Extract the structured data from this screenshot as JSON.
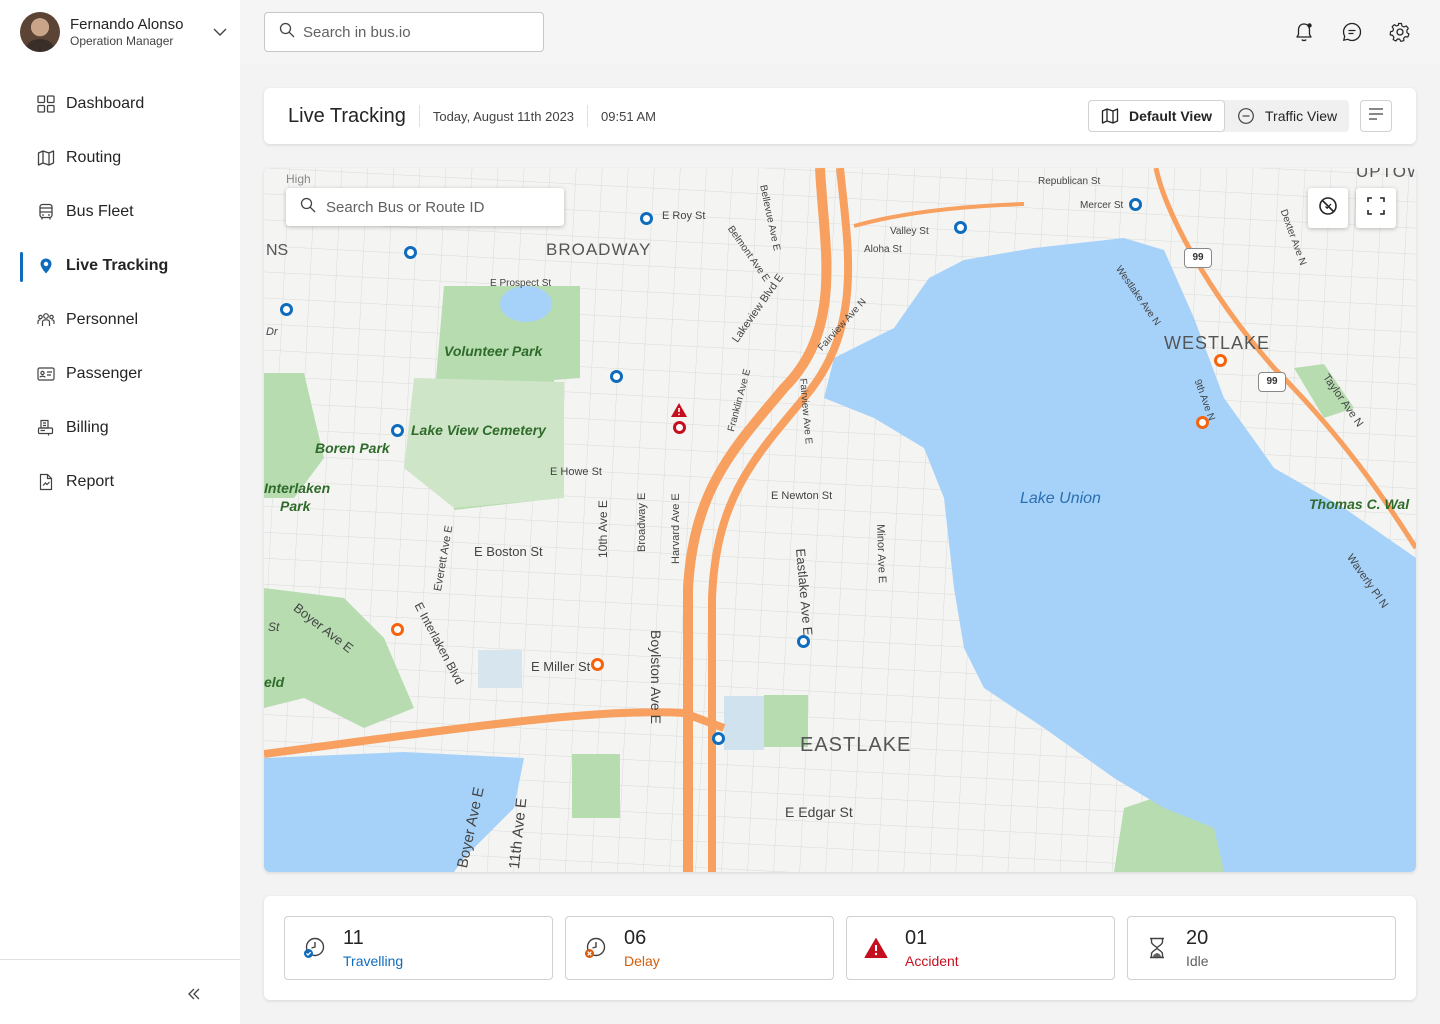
{
  "user": {
    "name": "Fernando Alonso",
    "role": "Operation Manager"
  },
  "nav": {
    "items": [
      {
        "label": "Dashboard",
        "icon": "grid-icon"
      },
      {
        "label": "Routing",
        "icon": "map-icon"
      },
      {
        "label": "Bus Fleet",
        "icon": "bus-icon"
      },
      {
        "label": "Live Tracking",
        "icon": "location-pin-icon",
        "active": true
      },
      {
        "label": "Personnel",
        "icon": "people-icon"
      },
      {
        "label": "Passenger",
        "icon": "contact-card-icon"
      },
      {
        "label": "Billing",
        "icon": "receipt-icon"
      },
      {
        "label": "Report",
        "icon": "document-icon"
      }
    ]
  },
  "search": {
    "placeholder": "Search in bus.io"
  },
  "header": {
    "title": "Live Tracking",
    "date": "Today, August 11th 2023",
    "time": "09:51 AM",
    "views": {
      "default": "Default View",
      "traffic": "Traffic View",
      "active": "default"
    }
  },
  "map": {
    "search_placeholder": "Search Bus or Route ID",
    "labels": {
      "broadway": "BROADWAY",
      "westlake": "WESTLAKE",
      "eastlake": "EASTLAKE",
      "lake_union": "Lake Union",
      "volunteer_park": "Volunteer Park",
      "lake_view_cemetery": "Lake View Cemetery",
      "boren_park": "Boren Park",
      "interlaken_park_1": "Interlaken",
      "interlaken_park_2": "Park",
      "thomas": "Thomas C. Wal",
      "uptown": "UPTOWN",
      "high": "High",
      "ns": "NS",
      "eld": "eld",
      "st": "St",
      "dr": "Dr",
      "e_roy": "E Roy St",
      "e_prospect": "E Prospect St",
      "e_howe": "E Howe St",
      "e_newton": "E Newton St",
      "e_boston": "E Boston St",
      "e_miller": "E Miller St",
      "e_edgar": "E Edgar St",
      "boylston": "Boylston Ave E",
      "eastlake_ave": "Eastlake Ave E",
      "tenth_ave": "10th Ave E",
      "harvard": "Harvard Ave E",
      "broadway_e": "Broadway E",
      "everett": "Everett Ave E",
      "interlaken_blvd": "E Interlaken Blvd",
      "boyer": "Boyer Ave E",
      "boyer2": "Boyer Ave E",
      "eleventh": "11th Ave E",
      "minor": "Minor Ave E",
      "franklin": "Franklin Ave E",
      "fairview": "Fairview Ave E",
      "fairview_n": "Fairview Ave N",
      "lakeview": "Lakeview Blvd E",
      "belmont": "Belmont Ave E",
      "bellevue": "Bellevue Ave E",
      "westlake_ave": "Westlake Ave N",
      "valley": "Valley St",
      "aloha": "Aloha St",
      "republican": "Republican St",
      "mercer": "Mercer St",
      "ninth": "9th Ave N",
      "dexter": "Dexter Ave N",
      "taylor": "Taylor Ave N",
      "waverly": "Waverly Pl N",
      "route_99": "99"
    }
  },
  "stats": [
    {
      "value": "11",
      "label": "Travelling",
      "color": "#0f6cbd",
      "icon": "clock-check-icon"
    },
    {
      "value": "06",
      "label": "Delay",
      "color": "#d65c0a",
      "icon": "clock-warning-icon"
    },
    {
      "value": "01",
      "label": "Accident",
      "color": "#c50f1f",
      "icon": "warning-triangle-icon"
    },
    {
      "value": "20",
      "label": "Idle",
      "color": "#616161",
      "icon": "hourglass-icon"
    }
  ],
  "colors": {
    "accent": "#0f6cbd",
    "delay": "#f7630c",
    "accident": "#c50f1f",
    "water": "#a6d2fa",
    "park": "#b6dcb0",
    "highway": "#f7a060"
  }
}
